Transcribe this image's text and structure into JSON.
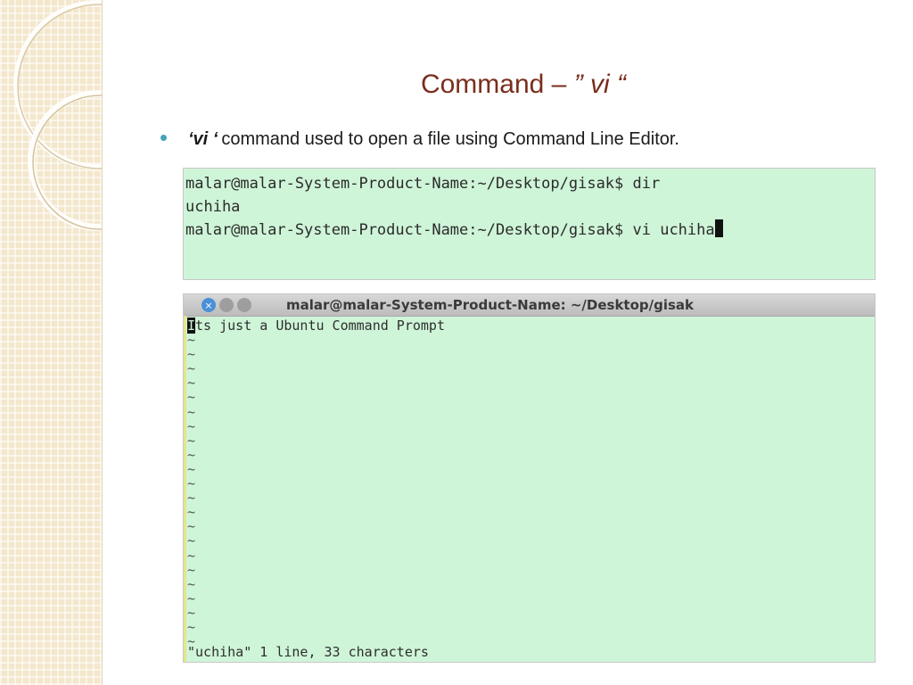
{
  "slide": {
    "title_prefix": "Command – ",
    "title_vi": "” vi “",
    "bullet_vi": "‘vi ‘",
    "bullet_text": "command used to open a file using Command Line Editor."
  },
  "terminal_1": {
    "lines": [
      "malar@malar-System-Product-Name:~/Desktop/gisak$ dir",
      "uchiha",
      "malar@malar-System-Product-Name:~/Desktop/gisak$ vi uchiha"
    ]
  },
  "terminal_2": {
    "window_title": "malar@malar-System-Product-Name: ~/Desktop/gisak",
    "close_glyph": "×",
    "first_line_cursor_char": "I",
    "first_line_rest": "ts just a Ubuntu Command Prompt",
    "tilde": "~",
    "tilde_count": 22,
    "status": "\"uchiha\" 1 line, 33 characters"
  },
  "colors": {
    "title": "#7a2e1c",
    "bullet": "#47a3b8",
    "terminal_bg": "#cff5d8"
  }
}
